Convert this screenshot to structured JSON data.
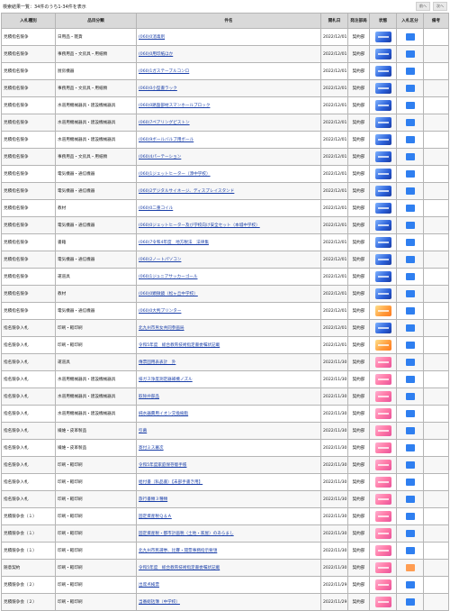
{
  "header": {
    "result_text": "検索結果一覧：34件のうち1-34件を表示",
    "prev_label": "前へ",
    "next_label": "次へ"
  },
  "columns": {
    "method": "入札種別",
    "category": "品目分類",
    "title": "件名",
    "date": "開札日",
    "dept": "発注部局",
    "status": "状態",
    "kind": "入札区分",
    "note": "備考"
  },
  "colors": {
    "link": "#1a3fa8",
    "icon_blue": "#2b60d8",
    "icon_pink": "#ff7aa8",
    "icon_orange": "#ff9a3a",
    "badge_blue": "#2f7ff0",
    "badge_orange": "#ff9d52"
  },
  "rows": [
    {
      "method": "見積指名競争",
      "category": "日用品・雑貨",
      "title": "(060)0消毒剤",
      "date": "2022/12/01",
      "dept": "契約部",
      "status": "blue",
      "kind": "blue"
    },
    {
      "method": "見積指名競争",
      "category": "事務用品・文房具・用紙類",
      "title": "(060)0用印紙ほか",
      "date": "2022/12/01",
      "dept": "契約部",
      "status": "blue",
      "kind": "blue"
    },
    {
      "method": "見積指名競争",
      "category": "厨房機器",
      "title": "(060)1ガステーブルコンロ",
      "date": "2022/12/01",
      "dept": "契約部",
      "status": "blue",
      "kind": "blue"
    },
    {
      "method": "見積指名競争",
      "category": "事務用品・文房具・用紙類",
      "title": "(060)0小型書ラック",
      "date": "2022/12/01",
      "dept": "契約部",
      "status": "blue",
      "kind": "blue"
    },
    {
      "method": "見積指名競争",
      "category": "水道用機械器具・建設機械器具",
      "title": "(060)0路盤部材スマンホールブロック",
      "date": "2022/12/01",
      "dept": "契約部",
      "status": "blue",
      "kind": "blue"
    },
    {
      "method": "見積指名競争",
      "category": "水道用機械器具・建設機械器具",
      "title": "(060)7ペアリングピストン",
      "date": "2022/12/01",
      "dept": "契約部",
      "status": "blue",
      "kind": "blue"
    },
    {
      "method": "見積指名競争",
      "category": "水道用機械器具・建設機械器具",
      "title": "(060)9ボールバルブ用ボール",
      "date": "2022/12/01",
      "dept": "契約部",
      "status": "blue",
      "kind": "blue"
    },
    {
      "method": "見積指名競争",
      "category": "事務用品・文房具・用紙類",
      "title": "(060)4パーテーション",
      "date": "2022/12/01",
      "dept": "契約部",
      "status": "blue",
      "kind": "blue"
    },
    {
      "method": "見積指名競争",
      "category": "電気機器・通信機器",
      "title": "(060)1ジェットヒーター（添中学校）",
      "date": "2022/12/01",
      "dept": "契約部",
      "status": "blue",
      "kind": "blue"
    },
    {
      "method": "見積指名競争",
      "category": "電気機器・通信機器",
      "title": "(060)2デジタルサイネージ、ディスプレイスタンド",
      "date": "2022/12/01",
      "dept": "契約部",
      "status": "blue",
      "kind": "blue"
    },
    {
      "method": "見積指名競争",
      "category": "教材",
      "title": "(060)0二重コイル",
      "date": "2022/12/01",
      "dept": "契約部",
      "status": "blue",
      "kind": "blue"
    },
    {
      "method": "見積指名競争",
      "category": "電気機器・通信機器",
      "title": "(060)0ジェットヒーター及び学校向け安全セット（本城中学校）",
      "date": "2022/12/01",
      "dept": "契約部",
      "status": "blue",
      "kind": "blue"
    },
    {
      "method": "見積指名競争",
      "category": "書籍",
      "title": "(060)7令和4年度　地方税法　法律集",
      "date": "2022/12/01",
      "dept": "契約部",
      "status": "blue",
      "kind": "blue"
    },
    {
      "method": "見積指名競争",
      "category": "電気機器・通信機器",
      "title": "(060)2ノートパソコン",
      "date": "2022/12/01",
      "dept": "契約部",
      "status": "blue",
      "kind": "blue"
    },
    {
      "method": "見積指名競争",
      "category": "運道具",
      "title": "(060)1ジュニアサッカーゴール",
      "date": "2022/12/01",
      "dept": "契約部",
      "status": "blue",
      "kind": "blue"
    },
    {
      "method": "見積指名競争",
      "category": "教材",
      "title": "(060)0顕微鏡（松ヶ丘中学校）",
      "date": "2022/12/01",
      "dept": "契約部",
      "status": "blue",
      "kind": "blue"
    },
    {
      "method": "見積指名競争",
      "category": "電気機器・通信機器",
      "title": "(060)0大判プリンター",
      "date": "2022/12/01",
      "dept": "契約部",
      "status": "orange",
      "kind": "blue"
    },
    {
      "method": "指名競争入札",
      "category": "印刷・軽印刷",
      "title": "北九州市男女共同参画局",
      "date": "2022/12/01",
      "dept": "契約部",
      "status": "blue",
      "kind": "blue"
    },
    {
      "method": "指名競争入札",
      "category": "印刷・軽印刷",
      "title": "令和5年度　総合教育技術指定書委嘱状記載",
      "date": "2022/12/01",
      "dept": "契約部",
      "status": "orange",
      "kind": "blue"
    },
    {
      "method": "指名競争入札",
      "category": "運道具",
      "title": "傳票固用表表計　外",
      "date": "2022/11/30",
      "dept": "契約部",
      "status": "pink",
      "kind": "blue"
    },
    {
      "method": "指名競争入札",
      "category": "水道用機械器具・建設機械器具",
      "title": "排ガス浄度測定器補機ノズル",
      "date": "2022/11/30",
      "dept": "契約部",
      "status": "pink",
      "kind": "blue"
    },
    {
      "method": "指名競争入札",
      "category": "水道用機械器具・建設機械器具",
      "title": "取除弁部品",
      "date": "2022/11/30",
      "dept": "契約部",
      "status": "pink",
      "kind": "blue"
    },
    {
      "method": "指名競争入札",
      "category": "水道用機械器具・建設機械器具",
      "title": "純水器費用イオン交換樹脂",
      "date": "2022/11/30",
      "dept": "契約部",
      "status": "pink",
      "kind": "blue"
    },
    {
      "method": "指名競争入札",
      "category": "繊維・皮革製品",
      "title": "引幕",
      "date": "2022/11/30",
      "dept": "契約部",
      "status": "pink",
      "kind": "blue"
    },
    {
      "method": "指名競争入札",
      "category": "繊維・皮革製品",
      "title": "寄付ミス幕次",
      "date": "2022/11/30",
      "dept": "契約部",
      "status": "pink",
      "kind": "blue"
    },
    {
      "method": "指名競争入札",
      "category": "印刷・軽印刷",
      "title": "令和5年度家庭保存版手帳",
      "date": "2022/11/30",
      "dept": "契約部",
      "status": "pink",
      "kind": "blue"
    },
    {
      "method": "指名競争入札",
      "category": "印刷・軽印刷",
      "title": "給付書（私品書）【未部手書き用】",
      "date": "2022/11/30",
      "dept": "契約部",
      "status": "pink",
      "kind": "blue"
    },
    {
      "method": "指名競争入札",
      "category": "印刷・軽印刷",
      "title": "旅行書類３種類",
      "date": "2022/11/30",
      "dept": "契約部",
      "status": "pink",
      "kind": "blue"
    },
    {
      "method": "見積競争会（１）",
      "category": "印刷・軽印刷",
      "title": "固定資産税Ｑ＆Ａ",
      "date": "2022/11/30",
      "dept": "契約部",
      "status": "pink",
      "kind": "blue"
    },
    {
      "method": "見積競争会（１）",
      "category": "印刷・軽印刷",
      "title": "固定資産税・都市計画税（土地・家屋）のあらまし",
      "date": "2022/11/30",
      "dept": "契約部",
      "status": "pink",
      "kind": "blue"
    },
    {
      "method": "見積競争会（１）",
      "category": "印刷・軽印刷",
      "title": "北九州市民選挙、比賽・開票事務指示要領",
      "date": "2022/11/30",
      "dept": "契約部",
      "status": "pink",
      "kind": "blue"
    },
    {
      "method": "随意契約",
      "category": "印刷・軽印刷",
      "title": "令和5年度　総合教育技術指定書委嘱状記載",
      "date": "2022/11/30",
      "dept": "契約部",
      "status": "pink",
      "kind": "orange"
    },
    {
      "method": "見積競争会（２）",
      "category": "印刷・軽印刷",
      "title": "出席点検票",
      "date": "2022/11/29",
      "dept": "契約部",
      "status": "pink",
      "kind": "blue"
    },
    {
      "method": "見積競争会（２）",
      "category": "印刷・軽印刷",
      "title": "当番総括簿（中学校）",
      "date": "2022/11/29",
      "dept": "契約部",
      "status": "pink",
      "kind": "blue"
    }
  ]
}
